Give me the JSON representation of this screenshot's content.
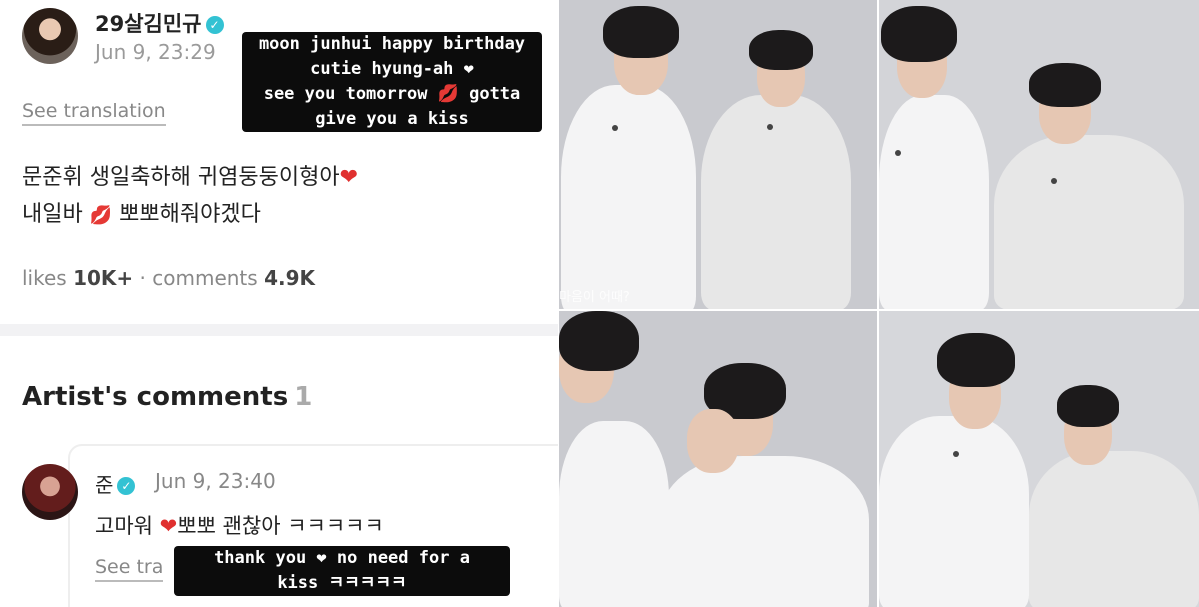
{
  "post": {
    "author": "29살김민규",
    "timestamp": "Jun 9, 23:29",
    "see_translation": "See translation",
    "body_line1": "문준휘 생일축하해 귀염둥둥이형아",
    "body_line2_a": "내일바",
    "body_line2_b": "뽀뽀해줘야겠다",
    "likes_label": "likes",
    "likes_value": "10K+",
    "separator": "·",
    "comments_label": "comments",
    "comments_value": "4.9K"
  },
  "artist_comments": {
    "heading": "Artist's comments",
    "count": "1",
    "comment": {
      "author": "준",
      "timestamp": "Jun 9, 23:40",
      "text_a": "고마워",
      "text_b": "뽀뽀 괜찮아 ㅋㅋㅋㅋㅋ",
      "see_translation": "See tra"
    }
  },
  "captions": {
    "top": [
      "moon junhui happy birthday",
      "cutie hyung-ah ❤",
      "see you tomorrow 💋 gotta",
      "give you a kiss"
    ],
    "bottom": [
      "thank you ❤ no need for a",
      "kiss ㅋㅋㅋㅋㅋ"
    ]
  },
  "photos": {
    "subtitle_1": "마음이 어때?"
  },
  "icons": {
    "verified": "verified-badge-icon",
    "heart": "heart-icon",
    "kiss": "kiss-mark-icon"
  },
  "colors": {
    "verified": "#33c2d3",
    "heart": "#e0302f",
    "caption_bg": "#0c0c0c"
  }
}
